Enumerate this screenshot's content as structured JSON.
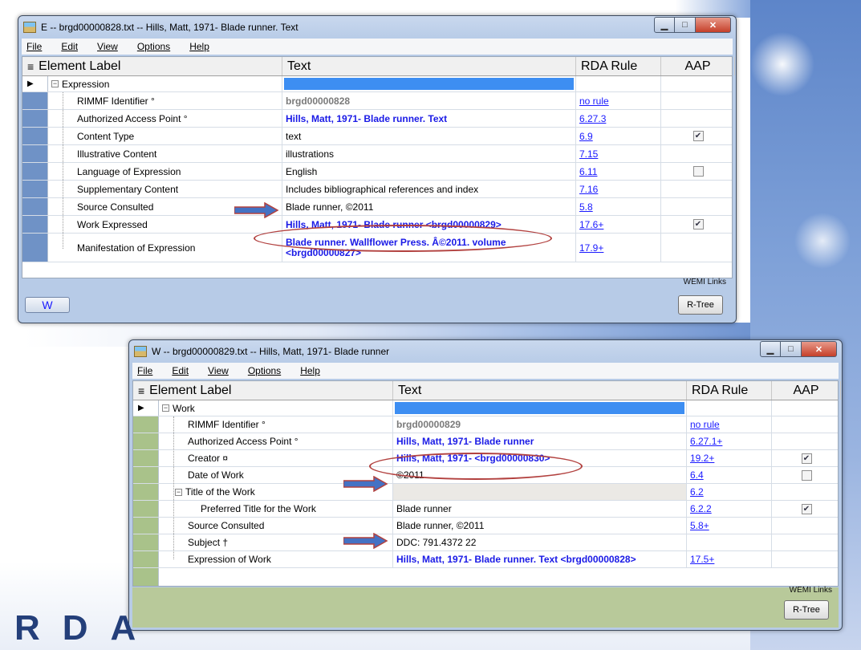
{
  "windowE": {
    "title": "E  --  brgd00000828.txt  --  Hills, Matt, 1971- Blade runner. Text",
    "menu": [
      "File",
      "Edit",
      "View",
      "Options",
      "Help"
    ],
    "headers": {
      "label": "Element Label",
      "text": "Text",
      "rule": "RDA Rule",
      "aap": "AAP"
    },
    "root": "Expression",
    "rows": [
      {
        "label": "RIMMF Identifier °",
        "text": "brgd00000828",
        "rule": "no rule",
        "aap": ""
      },
      {
        "label": "Authorized Access Point °",
        "text": "Hills, Matt, 1971- Blade runner. Text",
        "rule": "6.27.3",
        "aap": ""
      },
      {
        "label": "Content Type",
        "text": "text",
        "rule": "6.9",
        "aap": "checked"
      },
      {
        "label": "Illustrative Content",
        "text": "illustrations",
        "rule": "7.15",
        "aap": ""
      },
      {
        "label": "Language of Expression",
        "text": "English",
        "rule": "6.11",
        "aap": "unchecked"
      },
      {
        "label": "Supplementary Content",
        "text": "Includes bibliographical references and index",
        "rule": "7.16",
        "aap": ""
      },
      {
        "label": "Source Consulted",
        "text": "Blade runner, ©2011",
        "rule": "5.8",
        "aap": ""
      },
      {
        "label": "Work Expressed",
        "text": "Hills, Matt, 1971- Blade runner <brgd00000829>",
        "rule": "17.6+",
        "aap": "checked"
      },
      {
        "label": "Manifestation of Expression",
        "text_line1": "Blade runner. Wallflower Press. Â©2011. volume",
        "text_line2": "<brgd00000827>",
        "rule": "17.9+",
        "aap": ""
      }
    ],
    "wemi_label": "WEMI Links",
    "w_button": "W",
    "rtree_button": "R-Tree"
  },
  "windowW": {
    "title": "W  --  brgd00000829.txt  --  Hills, Matt, 1971- Blade runner",
    "menu": [
      "File",
      "Edit",
      "View",
      "Options",
      "Help"
    ],
    "headers": {
      "label": "Element Label",
      "text": "Text",
      "rule": "RDA Rule",
      "aap": "AAP"
    },
    "root": "Work",
    "rows": [
      {
        "label": "RIMMF Identifier °",
        "text": "brgd00000829",
        "rule": "no rule",
        "aap": ""
      },
      {
        "label": "Authorized Access Point °",
        "text": "Hills, Matt, 1971- Blade runner",
        "rule": "6.27.1+",
        "aap": ""
      },
      {
        "label": "Creator ¤",
        "text": "Hills, Matt, 1971- <brgd00000830>",
        "rule": "19.2+",
        "aap": "checked"
      },
      {
        "label": "Date of Work",
        "text": "©2011",
        "rule": "6.4",
        "aap": "unchecked"
      },
      {
        "label": "Title of the Work",
        "text": "",
        "rule": "6.2",
        "aap": ""
      },
      {
        "label": "Preferred Title for the Work",
        "text": "Blade runner",
        "rule": "6.2.2",
        "aap": "checked"
      },
      {
        "label": "Source Consulted",
        "text": "Blade runner, ©2011",
        "rule": "5.8+",
        "aap": ""
      },
      {
        "label": "Subject †",
        "text": "DDC: 791.4372 22",
        "rule": "",
        "aap": ""
      },
      {
        "label": "Expression of Work",
        "text": "Hills, Matt, 1971- Blade runner. Text <brgd00000828>",
        "rule": "17.5+",
        "aap": ""
      }
    ],
    "wemi_label": "WEMI Links",
    "rtree_button": "R-Tree"
  },
  "logo": "RDA"
}
